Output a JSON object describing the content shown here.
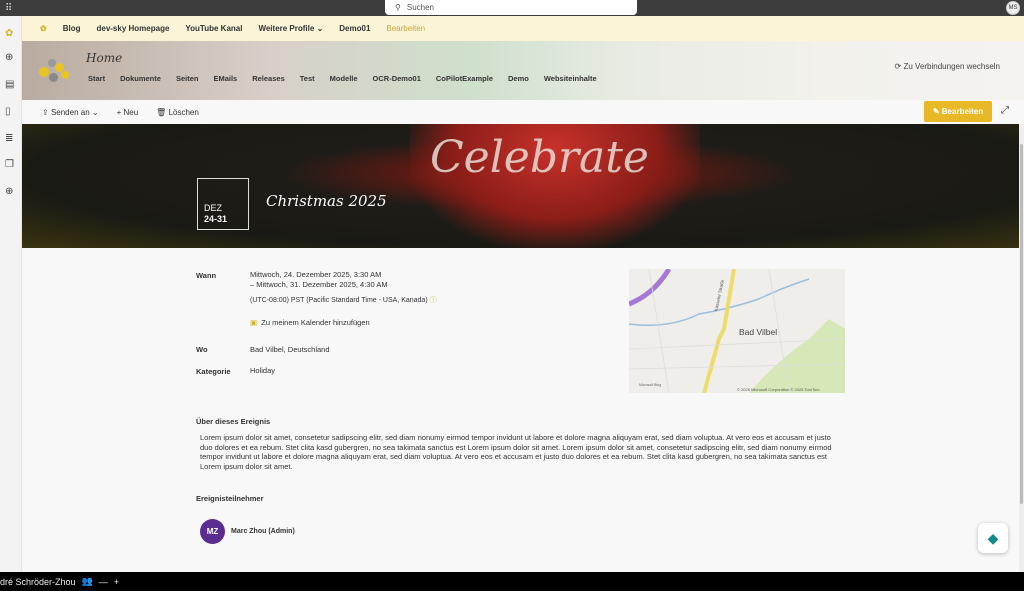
{
  "topbar": {
    "search_placeholder": "Suchen",
    "user_initials": "MS"
  },
  "hub_nav": {
    "items": [
      "Blog",
      "dev-sky Homepage",
      "YouTube Kanal",
      "Weitere Profile",
      "Demo01"
    ],
    "edit": "Bearbeiten"
  },
  "site": {
    "title": "Home",
    "nav": [
      "Start",
      "Dokumente",
      "Seiten",
      "EMails",
      "Releases",
      "Test",
      "Modelle",
      "OCR-Demo01",
      "CoPilotExample",
      "Demo",
      "Websiteinhalte"
    ],
    "switch_connections": "Zu Verbindungen wechseln"
  },
  "command_bar": {
    "send": "Senden an",
    "new": "Neu",
    "delete": "Löschen",
    "edit": "Bearbeiten"
  },
  "event": {
    "month": "DEZ",
    "days": "24-31",
    "title": "Christmas 2025",
    "hero_text": "Celebrate",
    "when_label": "Wann",
    "when_start": "Mittwoch, 24. Dezember 2025, 3:30 AM",
    "when_end": "– Mittwoch, 31. Dezember 2025, 4:30 AM",
    "timezone": "(UTC-08:00) PST (Pacific Standard Time - USA, Kanada)",
    "add_calendar": "Zu meinem Kalender hinzufügen",
    "where_label": "Wo",
    "where": "Bad Vilbel, Deutschland",
    "category_label": "Kategorie",
    "category": "Holiday",
    "about_label": "Über dieses Ereignis",
    "about_text": "Lorem ipsum dolor sit amet, consetetur sadipscing elitr, sed diam nonumy eirmod tempor invidunt ut labore et dolore magna aliquyam erat, sed diam voluptua. At vero eos et accusam et justo duo dolores et ea rebum. Stet clita kasd gubergren, no sea takimata sanctus est Lorem ipsum dolor sit amet. Lorem ipsum dolor sit amet, consetetur sadipscing elitr, sed diam nonumy eirmod tempor invidunt ut labore et dolore magna aliquyam erat, sed diam voluptua. At vero eos et accusam et justo duo dolores et ea rebum. Stet clita kasd gubergren, no sea takimata sanctus est Lorem ipsum dolor sit amet.",
    "attendees_label": "Ereignisteilnehmer",
    "attendee_initials": "MZ",
    "attendee_name": "Marc Zhou (Admin)"
  },
  "map": {
    "city": "Bad Vilbel",
    "street": "Kasseler Straße",
    "copyright": "© 2025 Microsoft Corporation © 2025 TomTom",
    "brand": "Microsoft Bing"
  },
  "taskbar": {
    "user": "dré Schröder-Zhou"
  }
}
